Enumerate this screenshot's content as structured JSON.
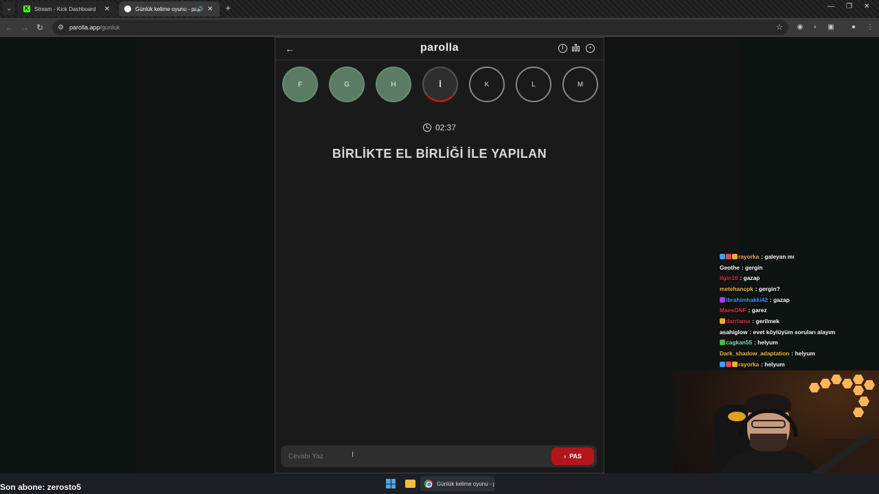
{
  "browser": {
    "tabs": [
      {
        "title": "Stream - Kick Dashboard",
        "favicon": "kick-icon"
      },
      {
        "title": "Günlük kelime oyunu - parolla",
        "favicon": "parolla-icon",
        "active": true
      }
    ],
    "url_host": "parolla.app",
    "url_path": "/gunluk"
  },
  "app": {
    "logo": "parolla",
    "letters": [
      {
        "label": "F",
        "state": "done"
      },
      {
        "label": "G",
        "state": "done"
      },
      {
        "label": "H",
        "state": "done"
      },
      {
        "label": "İ",
        "state": "active"
      },
      {
        "label": "K",
        "state": "pending"
      },
      {
        "label": "L",
        "state": "pending"
      },
      {
        "label": "M",
        "state": "pending"
      }
    ],
    "timer": "02:37",
    "question": "BİRLİKTE EL BİRLİĞİ İLE YAPILAN",
    "answer_placeholder": "Cevabı Yaz",
    "pass_label": "PAS",
    "colors": {
      "done": "#5c7b64",
      "active_ring": "#c0161a",
      "pass_button": "#b4151b"
    }
  },
  "chat": [
    {
      "user": "rayorka",
      "text": ": galeyan mı",
      "color": "#f4b642",
      "badges": [
        "#3aa0ff",
        "#e84060",
        "#f0b020"
      ]
    },
    {
      "user": "Geothe",
      "text": ": gergin",
      "color": "#ffffff",
      "badges": []
    },
    {
      "user": "ilgin10",
      "text": ": gazap",
      "color": "#e0304a",
      "badges": []
    },
    {
      "user": "metehancpk",
      "text": ": gergin?",
      "color": "#f4b642",
      "badges": []
    },
    {
      "user": "ibrahimhakki42",
      "text": ": gazap",
      "color": "#4a90ff",
      "badges": [
        "#a040ff"
      ]
    },
    {
      "user": "MaesONF",
      "text": ": garez",
      "color": "#e0304a",
      "badges": []
    },
    {
      "user": "darrlama",
      "text": ": gerilmek",
      "color": "#e0304a",
      "badges": [
        "#f0b020"
      ]
    },
    {
      "user": "asahiglow",
      "text": ": evet köylüyüm soruları alayım",
      "color": "#ffffff",
      "badges": []
    },
    {
      "user": "cagkan55",
      "text": ": helyum",
      "color": "#7ee0c0",
      "badges": [
        "#40c040"
      ]
    },
    {
      "user": "Dark_shadow_adaptation",
      "text": ": helyum",
      "color": "#f4b642",
      "badges": []
    },
    {
      "user": "rayorka",
      "text": ": helyum",
      "color": "#f4b642",
      "badges": [
        "#3aa0ff",
        "#e84060",
        "#f0b020"
      ]
    }
  ],
  "overlay": {
    "subscriber": "Son abone: zerosto5"
  },
  "taskbar": {
    "chrome_window": "Günlük kelime oyunu - parolla"
  }
}
